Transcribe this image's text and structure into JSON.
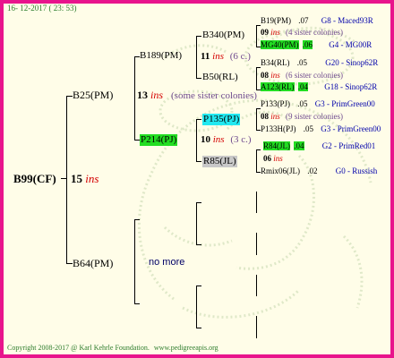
{
  "header": {
    "date": "16- 12-2017 ( 23: 53)"
  },
  "footer": {
    "copyright": "Copyright 2008-2017 @ Karl Kehrle Foundation.",
    "site": "www.pedigreeapis.org"
  },
  "colors": {
    "border": "#e8148c",
    "background": "#fffde8",
    "ins_red": "#d40000",
    "line_green": "#0000aa",
    "highlight_green": "#22dd22",
    "highlight_cyan": "#22e8f0"
  },
  "tree": {
    "root": {
      "name": "B99(CF)",
      "count": "15",
      "ins": "ins"
    },
    "gen1": {
      "top": {
        "name": "B25(PM)",
        "count": "13",
        "ins": "ins",
        "note": "(some sister colonies)"
      },
      "bottom": {
        "name": "B64(PM)",
        "note": "no more"
      }
    },
    "gen2": {
      "b189": {
        "name": "B189(PM)",
        "count": "11",
        "ins": "ins",
        "note": "(6 c.)"
      },
      "p214": {
        "name": "P214(PJ)",
        "count": "10",
        "ins": "ins",
        "note": "(3 c.)"
      }
    },
    "gen3": {
      "b340": "B340(PM)",
      "b50": "B50(RL)",
      "p135": "P135(PJ)",
      "r85": "R85(JL)"
    },
    "gen4": [
      {
        "name": "B19(PM)",
        "val": ".07",
        "line": "G8 - Maced93R"
      },
      {
        "count": "09",
        "ins": "ins",
        "note": "(4 sister colonies)"
      },
      {
        "name": "MG40(PM)",
        "val": ".06",
        "line": "G4 - MG00R"
      },
      {
        "name": "B34(RL)",
        "val": ".05",
        "line": "G20 - Sinop62R"
      },
      {
        "count": "08",
        "ins": "ins",
        "note": "(6 sister colonies)"
      },
      {
        "name": "A123(RL)",
        "val": ".04",
        "line": "G18 - Sinop62R"
      },
      {
        "name": "P133(PJ)",
        "val": ".05",
        "line": "G3 - PrimGreen00"
      },
      {
        "count": "08",
        "ins": "ins",
        "note": "(9 sister colonies)"
      },
      {
        "name": "P133H(PJ)",
        "val": ".05",
        "line": "G3 - PrimGreen00"
      },
      {
        "name": "R84(JL)",
        "val": ".04",
        "line": "G2 - PrimRed01"
      },
      {
        "count": "06",
        "ins": "ins",
        "note": ""
      },
      {
        "name": "Rmix06(JL)",
        "val": ".02",
        "line": "G0 - Russish"
      }
    ]
  }
}
